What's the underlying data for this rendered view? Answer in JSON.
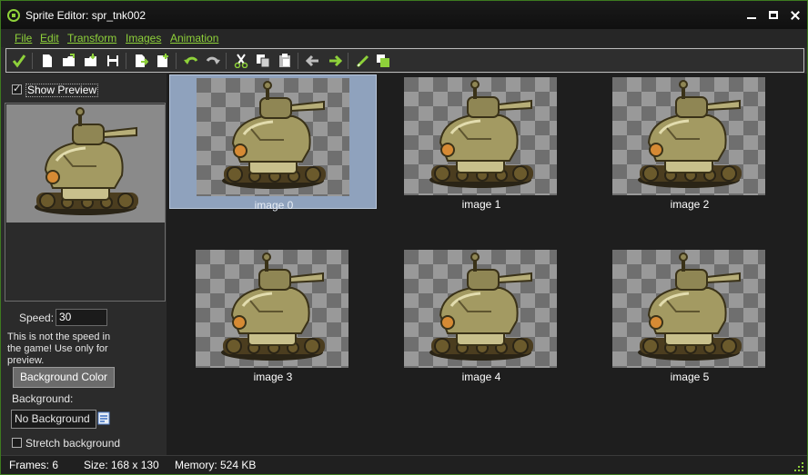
{
  "window": {
    "title": "Sprite Editor: spr_tnk002",
    "controls": {
      "minimize": "minimize",
      "maximize": "maximize",
      "close": "close"
    }
  },
  "menu": {
    "items": [
      "File",
      "Edit",
      "Transform",
      "Images",
      "Animation"
    ]
  },
  "toolbar": {
    "icons": [
      "checkmark-icon",
      "new-icon",
      "open-icon",
      "open-strip-icon",
      "save-icon",
      "add-image-icon",
      "insert-image-icon",
      "undo-icon",
      "redo-icon",
      "cut-icon",
      "copy-icon",
      "paste-icon",
      "move-left-icon",
      "move-right-icon",
      "edit-image-icon",
      "edit-background-icon"
    ]
  },
  "left_panel": {
    "show_preview": {
      "label": "Show Preview",
      "checked": true
    },
    "speed": {
      "label": "Speed:",
      "value": "30"
    },
    "note": "This is not the speed in the game! Use only for preview.",
    "background_color_button": "Background Color",
    "background": {
      "label": "Background:",
      "value": "No Background"
    },
    "stretch_background": {
      "label": "Stretch background",
      "checked": false
    }
  },
  "images": [
    {
      "label": "image 0",
      "selected": true
    },
    {
      "label": "image 1",
      "selected": false
    },
    {
      "label": "image 2",
      "selected": false
    },
    {
      "label": "image 3",
      "selected": false
    },
    {
      "label": "image 4",
      "selected": false
    },
    {
      "label": "image 5",
      "selected": false
    }
  ],
  "status": {
    "frames": "Frames: 6",
    "size": "Size: 168 x 130",
    "memory": "Memory: 524 KB"
  },
  "colors": {
    "accent": "#8ed13a",
    "selection": "#8fa2bd"
  }
}
